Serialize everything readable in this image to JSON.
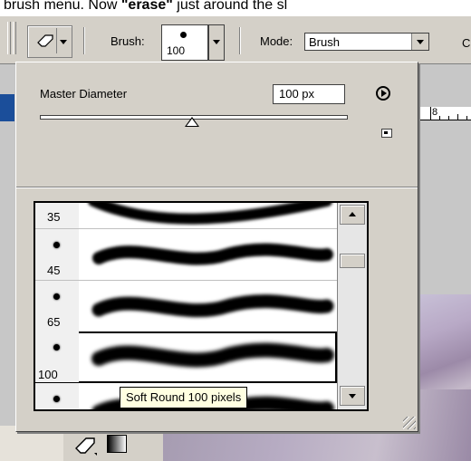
{
  "caption": {
    "before": "brush menu. Now ",
    "bold": "\"erase\"",
    "after": " just around the sl"
  },
  "options_bar": {
    "brush_label": "Brush:",
    "brush_size": "100",
    "mode_label": "Mode:",
    "mode_value": "Brush",
    "cutoff_label": "C"
  },
  "ruler": {
    "number": "8"
  },
  "brush_panel": {
    "master_diameter_label": "Master Diameter",
    "master_diameter_value": "100 px",
    "presets": [
      {
        "size": "35"
      },
      {
        "size": "45"
      },
      {
        "size": "65"
      },
      {
        "size": "100",
        "selected": true
      },
      {
        "size": ""
      }
    ],
    "tooltip": "Soft Round 100 pixels"
  },
  "icons": {
    "tool_preset": "eraser-icon",
    "flyout": "flyout-menu-icon",
    "new_preset": "new-preset-icon",
    "gradient": "gradient-icon"
  }
}
